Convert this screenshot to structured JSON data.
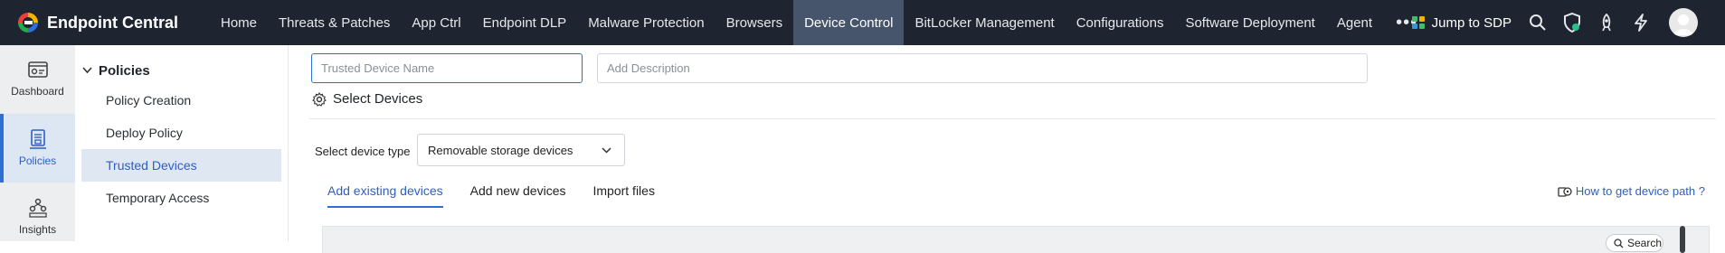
{
  "app": {
    "title": "Endpoint Central"
  },
  "nav": {
    "items": [
      {
        "label": "Home",
        "name": "nav-home"
      },
      {
        "label": "Threats & Patches",
        "name": "nav-threats-patches"
      },
      {
        "label": "App Ctrl",
        "name": "nav-app-ctrl"
      },
      {
        "label": "Endpoint DLP",
        "name": "nav-endpoint-dlp"
      },
      {
        "label": "Malware Protection",
        "name": "nav-malware-protection"
      },
      {
        "label": "Browsers",
        "name": "nav-browsers"
      },
      {
        "label": "Device Control",
        "name": "nav-device-control"
      },
      {
        "label": "BitLocker Management",
        "name": "nav-bitlocker-management"
      },
      {
        "label": "Configurations",
        "name": "nav-configurations"
      },
      {
        "label": "Software Deployment",
        "name": "nav-software-deployment"
      },
      {
        "label": "Agent",
        "name": "nav-agent"
      }
    ],
    "active": "Device Control",
    "more_icon": "more-icon"
  },
  "topright": {
    "jump_label": "Jump to SDP",
    "icons": [
      "search-icon",
      "shield-icon",
      "rocket-icon",
      "lightning-icon",
      "avatar"
    ]
  },
  "rail": {
    "items": [
      {
        "label": "Dashboard",
        "icon": "dashboard-icon"
      },
      {
        "label": "Policies",
        "icon": "policies-icon"
      },
      {
        "label": "Insights",
        "icon": "insights-icon"
      }
    ],
    "active": "Policies"
  },
  "sidebar": {
    "heading": "Policies",
    "items": [
      {
        "label": "Policy Creation"
      },
      {
        "label": "Deploy Policy"
      },
      {
        "label": "Trusted Devices"
      },
      {
        "label": "Temporary Access"
      }
    ],
    "active": "Trusted Devices"
  },
  "form": {
    "name_placeholder": "Trusted Device Name",
    "desc_placeholder": "Add Description",
    "section_title": "Select Devices",
    "device_type_label": "Select device type",
    "device_type_value": "Removable storage devices"
  },
  "tabs": {
    "items": [
      {
        "label": "Add existing devices"
      },
      {
        "label": "Add new devices"
      },
      {
        "label": "Import files"
      }
    ],
    "active": "Add existing devices"
  },
  "help": {
    "label": "How to get device path ?"
  },
  "table": {
    "search_label": "Search"
  },
  "colors": {
    "topbar_bg": "#1f2530",
    "active_nav_bg": "#46556b",
    "accent": "#2f6fd6",
    "link": "#2f5fbf"
  }
}
